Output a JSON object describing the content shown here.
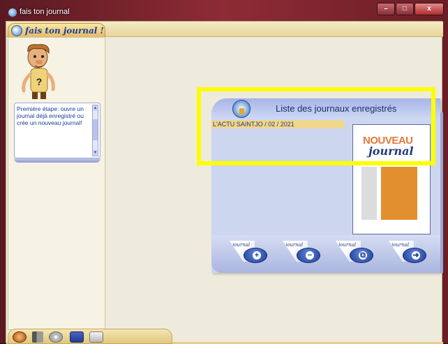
{
  "window": {
    "title": "fais ton journal",
    "controls": {
      "minimize": "–",
      "maximize": "□",
      "close": "x"
    }
  },
  "app": {
    "logo_text": "fais ton journal !"
  },
  "sidebar": {
    "message": "Première étape: ouvre un journal déjà enregistré ou crée un nouveau journal!"
  },
  "panel": {
    "title": "Liste des journaux enregistrés",
    "journals": [
      "L'ACTU SAINTJO / 02 / 2021"
    ],
    "preview": {
      "line1": "NOUVEAU",
      "line2": "journal"
    },
    "actions": [
      {
        "tab": "journal",
        "glyph": "+",
        "icon": "add-journal-icon"
      },
      {
        "tab": "journal",
        "glyph": "−",
        "icon": "remove-journal-icon"
      },
      {
        "tab": "journal",
        "glyph": "⧉",
        "icon": "open-journal-icon"
      },
      {
        "tab": "journal",
        "glyph": "➜",
        "icon": "next-journal-icon"
      }
    ]
  },
  "bottom_toolbar": {
    "icons": [
      "exit-icon",
      "speaker-icon",
      "disc-icon",
      "book-icon",
      "printer-icon"
    ]
  },
  "colors": {
    "highlight": "#fbff00",
    "panel_bg": "#cdd6ef",
    "accent_blue": "#1e3e9a",
    "accent_orange": "#e2902f"
  }
}
